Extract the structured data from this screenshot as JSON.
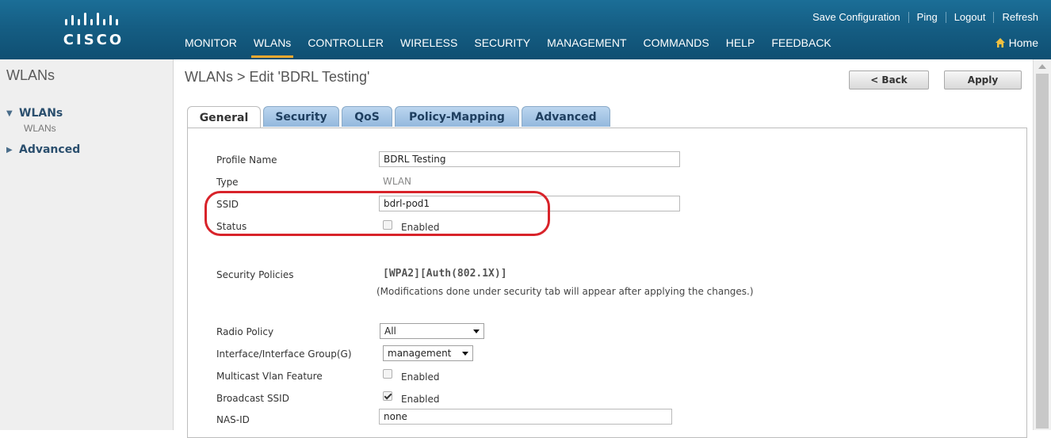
{
  "brand": {
    "logo_text": "CISCO"
  },
  "utility_links": [
    "Save Configuration",
    "Ping",
    "Logout",
    "Refresh"
  ],
  "nav": {
    "items": [
      "MONITOR",
      "WLANs",
      "CONTROLLER",
      "WIRELESS",
      "SECURITY",
      "MANAGEMENT",
      "COMMANDS",
      "HELP",
      "FEEDBACK"
    ],
    "active": "WLANs",
    "home_label": "Home"
  },
  "sidebar": {
    "title": "WLANs",
    "items": [
      {
        "label": "WLANs",
        "expanded": true,
        "children": [
          "WLANs"
        ]
      },
      {
        "label": "Advanced",
        "expanded": false
      }
    ]
  },
  "page": {
    "title": "WLANs > Edit  'BDRL Testing'",
    "back_label": "< Back",
    "apply_label": "Apply"
  },
  "tabs": [
    "General",
    "Security",
    "QoS",
    "Policy-Mapping",
    "Advanced"
  ],
  "active_tab": "General",
  "form": {
    "profile_name": {
      "label": "Profile Name",
      "value": "BDRL Testing"
    },
    "type": {
      "label": "Type",
      "value": "WLAN"
    },
    "ssid": {
      "label": "SSID",
      "value": "bdrl-pod1"
    },
    "status": {
      "label": "Status",
      "checkbox_label": "Enabled",
      "checked": false
    },
    "security_policies": {
      "label": "Security Policies",
      "value": "[WPA2][Auth(802.1X)]",
      "note": "(Modifications done under security tab will appear after applying the changes.)"
    },
    "radio_policy": {
      "label": "Radio Policy",
      "selected": "All"
    },
    "interface_group": {
      "label": "Interface/Interface Group(G)",
      "selected": "management"
    },
    "multicast_vlan": {
      "label": "Multicast Vlan Feature",
      "checkbox_label": "Enabled",
      "checked": false
    },
    "broadcast_ssid": {
      "label": "Broadcast SSID",
      "checkbox_label": "Enabled",
      "checked": true
    },
    "nas_id": {
      "label": "NAS-ID",
      "value": "none"
    }
  },
  "colors": {
    "header": "#155e84",
    "nav_active_underline": "#f0a830",
    "tab_inactive": "#a9c8e6",
    "annotation_circle": "#d8232a"
  }
}
